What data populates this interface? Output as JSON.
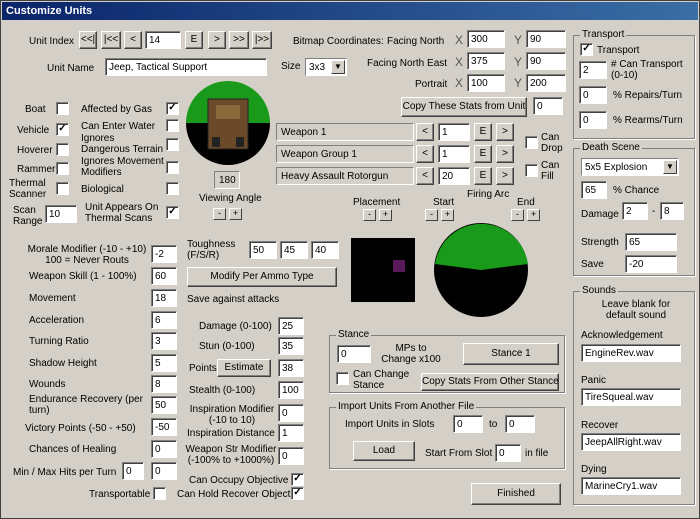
{
  "window": {
    "title": "Customize Units"
  },
  "unit": {
    "index_label": "Unit Index",
    "index": "14",
    "name_label": "Unit Name",
    "name": "Jeep, Tactical Support",
    "size_label": "Size",
    "size": "3x3",
    "nav": [
      "<<|",
      "|<<",
      "<",
      "E",
      ">",
      ">>",
      "|>>"
    ]
  },
  "bitmap": {
    "label": "Bitmap Coordinates:",
    "rows": [
      {
        "label": "Facing North",
        "x": "300",
        "y": "90"
      },
      {
        "label": "Facing North East",
        "x": "375",
        "y": "90"
      },
      {
        "label": "Portrait",
        "x": "100",
        "y": "200"
      }
    ],
    "xl": "X",
    "yl": "Y",
    "copy_btn": "Copy These Stats from Unit",
    "copy_val": "0"
  },
  "flags_left": [
    {
      "label": "Boat",
      "on": false
    },
    {
      "label": "Vehicle",
      "on": true
    },
    {
      "label": "Hoverer",
      "on": false
    },
    {
      "label": "Rammer",
      "on": false
    },
    {
      "label": "Thermal Scanner",
      "on": false
    }
  ],
  "flags_mid": [
    {
      "label": "Affected by Gas",
      "on": true
    },
    {
      "label": "Can Enter Water",
      "on": false
    },
    {
      "label": "Ignores Dangerous Terrain",
      "on": false
    },
    {
      "label": "Ignores Movement Modifiers",
      "on": false
    },
    {
      "label": "Biological",
      "on": false
    }
  ],
  "scan": {
    "label": "Scan Range",
    "value": "10",
    "thermal_label": "Unit Appears On Thermal Scans",
    "thermal_on": true
  },
  "angle": {
    "value": "180",
    "label": "Viewing Angle"
  },
  "weapons": [
    {
      "name": "Weapon 1",
      "value": "1"
    },
    {
      "name": "Weapon Group 1",
      "value": "1"
    },
    {
      "name": "Heavy Assault Rotorgun",
      "value": "20"
    }
  ],
  "weapon_flags": [
    {
      "label": "Can Drop",
      "on": false
    },
    {
      "label": "Can Fill",
      "on": false
    }
  ],
  "arc": {
    "placement": "Placement",
    "start": "Start",
    "firing_arc": "Firing Arc",
    "end": "End",
    "minus": "-",
    "plus": "+"
  },
  "stats": [
    {
      "label": "Morale Modifier (-10 - +10) 100 = Never Routs",
      "value": "-2"
    },
    {
      "label": "Weapon Skill (1 - 100%)",
      "value": "60"
    },
    {
      "label": "Movement",
      "value": "18"
    },
    {
      "label": "Acceleration",
      "value": "6"
    },
    {
      "label": "Turning Ratio",
      "value": "3"
    },
    {
      "label": "Shadow Height",
      "value": "5"
    },
    {
      "label": "Wounds",
      "value": "8"
    },
    {
      "label": "Endurance Recovery (per turn)",
      "value": "50"
    },
    {
      "label": "Victory Points (-50 - +50)",
      "value": "-50"
    },
    {
      "label": "Chances of Healing",
      "value": "0"
    }
  ],
  "minmax": {
    "label": "Min / Max Hits per Turn",
    "min": "0",
    "max": "0"
  },
  "transportable": {
    "label": "Transportable",
    "on": false
  },
  "toughness": {
    "label": "Toughness (F/S/R)",
    "f": "50",
    "s": "45",
    "r": "40",
    "modify_btn": "Modify Per Ammo Type",
    "save_label": "Save against attacks"
  },
  "mid_stats": {
    "damage_label": "Damage (0-100)",
    "damage": "25",
    "stun_label": "Stun (0-100)",
    "stun": "35",
    "points_label": "Points",
    "estimate_btn": "Estimate",
    "points": "38",
    "stealth_label": "Stealth (0-100)",
    "stealth": "100",
    "insp_mod_label": "Inspiration Modifier (-10 to 10)",
    "insp_mod": "0",
    "insp_dist_label": "Inspiration Distance",
    "insp_dist": "1",
    "wstr_label": "Weapon Str Modifier (-100% to +1000%)",
    "wstr": "0",
    "occupy_label": "Can Occupy Objective",
    "occupy_on": true,
    "recover_label": "Can Hold Recover Object",
    "recover_on": true
  },
  "stance": {
    "title": "Stance",
    "mp_value": "0",
    "mp_label": "MPs to Change x100",
    "stance_btn": "Stance 1",
    "can_change_label": "Can Change Stance",
    "can_change_on": false,
    "copy_btn": "Copy Stats From Other Stance"
  },
  "import": {
    "title": "Import Units From Another File",
    "slots_label": "Import Units in Slots",
    "from": "0",
    "to_label": "to",
    "to": "0",
    "load_btn": "Load",
    "start_label": "Start From Slot",
    "start": "0",
    "infile": "in file"
  },
  "finished_btn": "Finished",
  "transport": {
    "title": "Transport",
    "chk_label": "Transport",
    "chk_on": true,
    "rows": [
      {
        "value": "2",
        "label": "# Can Transport (0-10)"
      },
      {
        "value": "0",
        "label": "% Repairs/Turn"
      },
      {
        "value": "0",
        "label": "% Rearms/Turn"
      }
    ]
  },
  "death": {
    "title": "Death Scene",
    "scene": "5x5 Explosion",
    "chance": "65",
    "chance_label": "% Chance",
    "damage_label": "Damage",
    "dmin": "2",
    "dash": "-",
    "dmax": "8",
    "strength_label": "Strength",
    "strength": "65",
    "save_label": "Save",
    "save": "-20"
  },
  "sounds": {
    "title": "Sounds",
    "note": "Leave blank for default sound",
    "items": [
      {
        "label": "Acknowledgement",
        "file": "EngineRev.wav"
      },
      {
        "label": "Panic",
        "file": "TireSqueal.wav"
      },
      {
        "label": "Recover",
        "file": "JeepAllRight.wav"
      },
      {
        "label": "Dying",
        "file": "MarineCry1.wav"
      }
    ]
  },
  "colors": {
    "arc_green": "#1a9a1a",
    "dark": "#000000",
    "purple": "#5a1a5a"
  }
}
